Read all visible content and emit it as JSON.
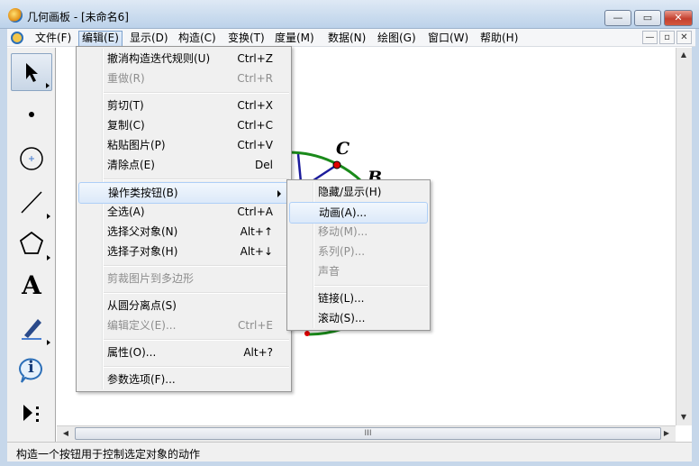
{
  "window": {
    "title": "几何画板 - [未命名6]",
    "close_glyph": "✕",
    "max_glyph": "▭",
    "min_glyph": "—"
  },
  "menubar": {
    "items": [
      "文件(F)",
      "编辑(E)",
      "显示(D)",
      "构造(C)",
      "变换(T)",
      "度量(M)",
      "数据(N)",
      "绘图(G)",
      "窗口(W)",
      "帮助(H)"
    ],
    "active": "编辑(E)",
    "mdi_buttons": [
      "—",
      "▫",
      "✕"
    ]
  },
  "toolbox": {
    "tools": [
      "arrow-tool",
      "point-tool",
      "compass-tool",
      "straightedge-tool",
      "polygon-tool",
      "text-tool",
      "marker-tool",
      "information-tool",
      "custom-tool"
    ],
    "text_tool_glyph": "A",
    "info_glyph": "i"
  },
  "canvas": {
    "point_labels": [
      "C",
      "B"
    ],
    "circle_color": "#1a8a1a",
    "segment_color": "#1c1c9c",
    "point_color": "#e00000"
  },
  "edit_menu": {
    "items": [
      {
        "label": "撤消构造迭代规则(U)",
        "shortcut": "Ctrl+Z",
        "disabled": false
      },
      {
        "label": "重做(R)",
        "shortcut": "Ctrl+R",
        "disabled": true
      },
      {
        "label": "剪切(T)",
        "shortcut": "Ctrl+X",
        "disabled": false
      },
      {
        "label": "复制(C)",
        "shortcut": "Ctrl+C",
        "disabled": false
      },
      {
        "label": "粘贴图片(P)",
        "shortcut": "Ctrl+V",
        "disabled": false
      },
      {
        "label": "清除点(E)",
        "shortcut": "Del",
        "disabled": false
      },
      {
        "label": "操作类按钮(B)",
        "shortcut": "",
        "disabled": false,
        "submenu": true
      },
      {
        "label": "全选(A)",
        "shortcut": "Ctrl+A",
        "disabled": false
      },
      {
        "label": "选择父对象(N)",
        "shortcut": "Alt+↑",
        "disabled": false
      },
      {
        "label": "选择子对象(H)",
        "shortcut": "Alt+↓",
        "disabled": false
      },
      {
        "label": "剪裁图片到多边形",
        "shortcut": "",
        "disabled": true
      },
      {
        "label": "从圆分离点(S)",
        "shortcut": "",
        "disabled": false
      },
      {
        "label": "编辑定义(E)...",
        "shortcut": "Ctrl+E",
        "disabled": true
      },
      {
        "label": "属性(O)...",
        "shortcut": "Alt+?",
        "disabled": false
      },
      {
        "label": "参数选项(F)...",
        "shortcut": "",
        "disabled": false
      }
    ]
  },
  "buttons_submenu": {
    "items": [
      {
        "label": "隐藏/显示(H)",
        "disabled": false
      },
      {
        "label": "动画(A)...",
        "disabled": false,
        "highlighted": true
      },
      {
        "label": "移动(M)...",
        "disabled": true
      },
      {
        "label": "系列(P)...",
        "disabled": true
      },
      {
        "label": "声音",
        "disabled": true
      },
      {
        "label": "链接(L)...",
        "disabled": false
      },
      {
        "label": "滚动(S)...",
        "disabled": false
      }
    ]
  },
  "scrollbars": {
    "hthumb_grip": "III",
    "left_arrow": "◀",
    "right_arrow": "▶",
    "up_arrow": "▲",
    "down_arrow": "▼"
  },
  "statusbar": {
    "text": "构造一个按钮用于控制选定对象的动作"
  }
}
